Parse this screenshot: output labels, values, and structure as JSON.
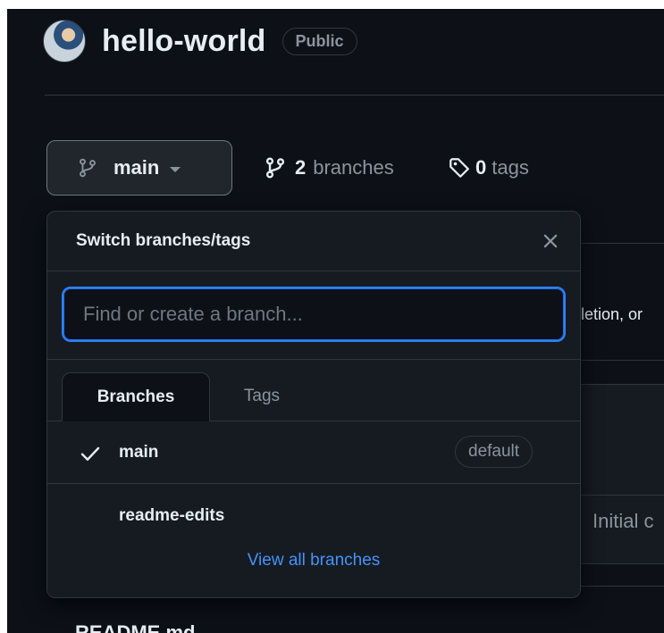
{
  "repo": {
    "name": "hello-world",
    "visibility": "Public"
  },
  "branch_bar": {
    "current_branch": "main",
    "branches_count": "2",
    "branches_label": "branches",
    "tags_count": "0",
    "tags_label": "tags"
  },
  "background": {
    "snippet_1": "letion, or",
    "snippet_2": "Initial c",
    "readme_label": "README.md"
  },
  "dropdown": {
    "title": "Switch branches/tags",
    "search_placeholder": "Find or create a branch...",
    "tabs": [
      {
        "label": "Branches",
        "active": true
      },
      {
        "label": "Tags",
        "active": false
      }
    ],
    "items": [
      {
        "label": "main",
        "selected": true,
        "badge": "default"
      },
      {
        "label": "readme-edits",
        "selected": false,
        "badge": ""
      }
    ],
    "footer_link": "View all branches"
  },
  "colors": {
    "bg": "#0d1117",
    "overlay": "#161b22",
    "border": "#30363d",
    "accent": "#2f81f7",
    "link": "#4493f8",
    "text": "#e6edf3",
    "muted": "#8b949e"
  },
  "icons": {
    "branch": "git-branch-icon",
    "tag": "tag-icon",
    "close": "close-icon",
    "check": "check-icon",
    "caret": "caret-down-icon"
  }
}
